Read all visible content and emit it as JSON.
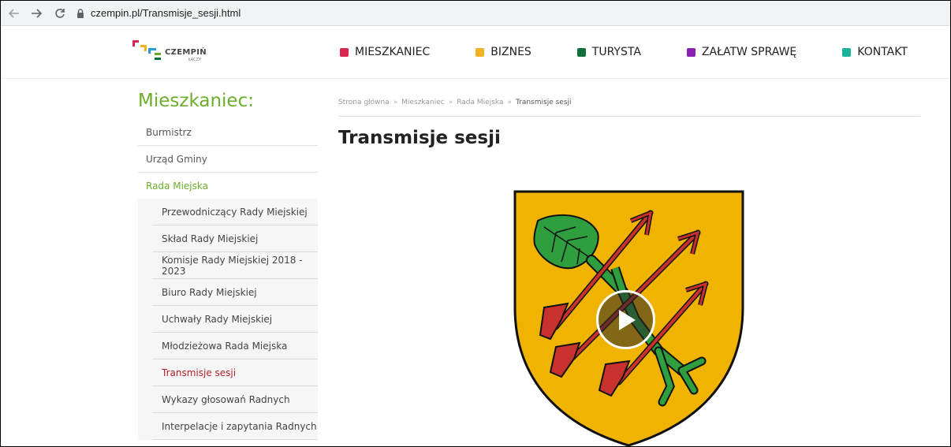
{
  "browser": {
    "back_icon": "arrow-left-icon",
    "forward_icon": "arrow-right-icon",
    "reload_icon": "reload-icon",
    "lock_icon": "lock-icon",
    "url": "czempin.pl/Transmisje_sesji.html"
  },
  "header": {
    "logo_text": "CZEMPIŃ",
    "logo_sub": "ŁĄCZY",
    "nav": [
      {
        "label": "MIESZKANIEC",
        "color": "#d7264f"
      },
      {
        "label": "BIZNES",
        "color": "#f0b323"
      },
      {
        "label": "TURYSTA",
        "color": "#11703a"
      },
      {
        "label": "ZAŁATW SPRAWĘ",
        "color": "#8a1fb0"
      },
      {
        "label": "KONTAKT",
        "color": "#19b29b"
      }
    ]
  },
  "sidebar": {
    "title": "Mieszkaniec:",
    "items": [
      {
        "label": "Burmistrz"
      },
      {
        "label": "Urząd Gminy"
      },
      {
        "label": "Rada Miejska"
      }
    ],
    "subitems": [
      {
        "label": "Przewodniczący Rady Miejskiej"
      },
      {
        "label": "Skład Rady Miejskiej"
      },
      {
        "label": "Komisje Rady Miejskiej 2018 - 2023"
      },
      {
        "label": "Biuro Rady Miejskiej"
      },
      {
        "label": "Uchwały Rady Miejskiej"
      },
      {
        "label": "Młodzieżowa Rada Miejska"
      },
      {
        "label": "Transmisje sesji"
      },
      {
        "label": "Wykazy głosowań Radnych"
      },
      {
        "label": "Interpelacje i zapytania Radnych"
      }
    ]
  },
  "breadcrumb": {
    "items": [
      "Strona główna",
      "Mieszkaniec",
      "Rada Miejska",
      "Transmisje sesji"
    ],
    "separator": "»"
  },
  "main": {
    "title": "Transmisje sesji"
  },
  "video": {
    "play_icon": "play-icon"
  },
  "colors": {
    "accent_green": "#6cae2b",
    "current_red": "#b0212c",
    "shield_gold": "#f0b400"
  }
}
